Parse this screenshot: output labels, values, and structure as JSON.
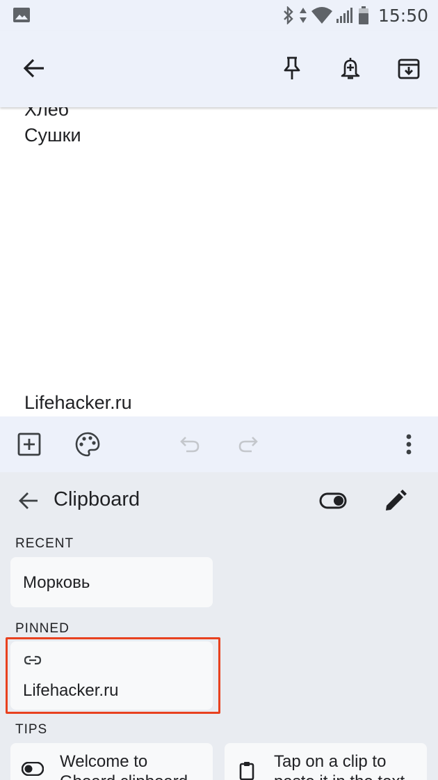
{
  "status_bar": {
    "time": "15:50",
    "icons": [
      "image-icon",
      "bluetooth-icon",
      "data-arrows-icon",
      "wifi-icon",
      "signal-icon",
      "battery-icon"
    ]
  },
  "app_bar": {
    "back_icon": "arrow-back-icon",
    "actions": [
      "pin-icon",
      "add-reminder-icon",
      "archive-icon"
    ]
  },
  "note": {
    "lines": [
      "Хлеб",
      "Сушки"
    ],
    "bottom_text": "Lifehacker.ru"
  },
  "note_toolbar": {
    "icons": [
      "add-box-icon",
      "palette-icon",
      "undo-icon",
      "redo-icon",
      "more-vert-icon"
    ]
  },
  "clipboard": {
    "title": "Clipboard",
    "recent_label": "RECENT",
    "recent_items": [
      "Морковь"
    ],
    "pinned_label": "PINNED",
    "pinned_items": [
      "Lifehacker.ru"
    ],
    "tips_label": "TIPS",
    "tips": [
      "Welcome to Gboard clipboard",
      "Tap on a clip to paste it in the text box"
    ]
  },
  "colors": {
    "bar_bg": "#edf1fa",
    "panel_bg": "#e9ecf1",
    "card_bg": "#f8f9fa",
    "highlight": "#e8411f"
  }
}
